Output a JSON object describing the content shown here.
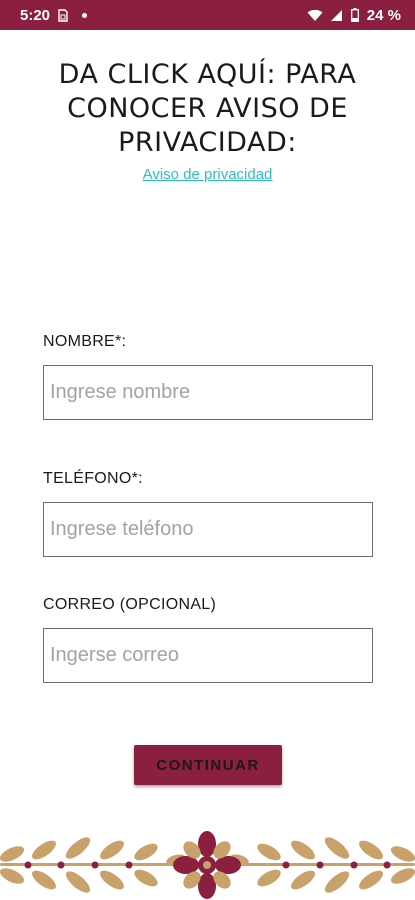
{
  "status_bar": {
    "time": "5:20",
    "battery": "24 %",
    "background_color": "#8b1f3f"
  },
  "privacy": {
    "title": "DA CLICK AQUÍ: PARA\nCONOCER AVISO DE\nPRIVACIDAD:",
    "link_label": "Aviso de privacidad",
    "link_color": "#2bbfc7"
  },
  "form": {
    "name_label": "NOMBRE*:",
    "name_placeholder": "Ingrese nombre",
    "phone_label": "TELÉFONO*:",
    "phone_placeholder": "Ingrese teléfono",
    "email_label": "CORREO (OPCIONAL)",
    "email_placeholder": "Ingerse correo"
  },
  "continue_button": {
    "label": "CONTINUAR",
    "color": "#8b1f3f"
  },
  "decoration": {
    "leaf_color": "#c9a26b",
    "flower_color": "#8b1f3f"
  }
}
